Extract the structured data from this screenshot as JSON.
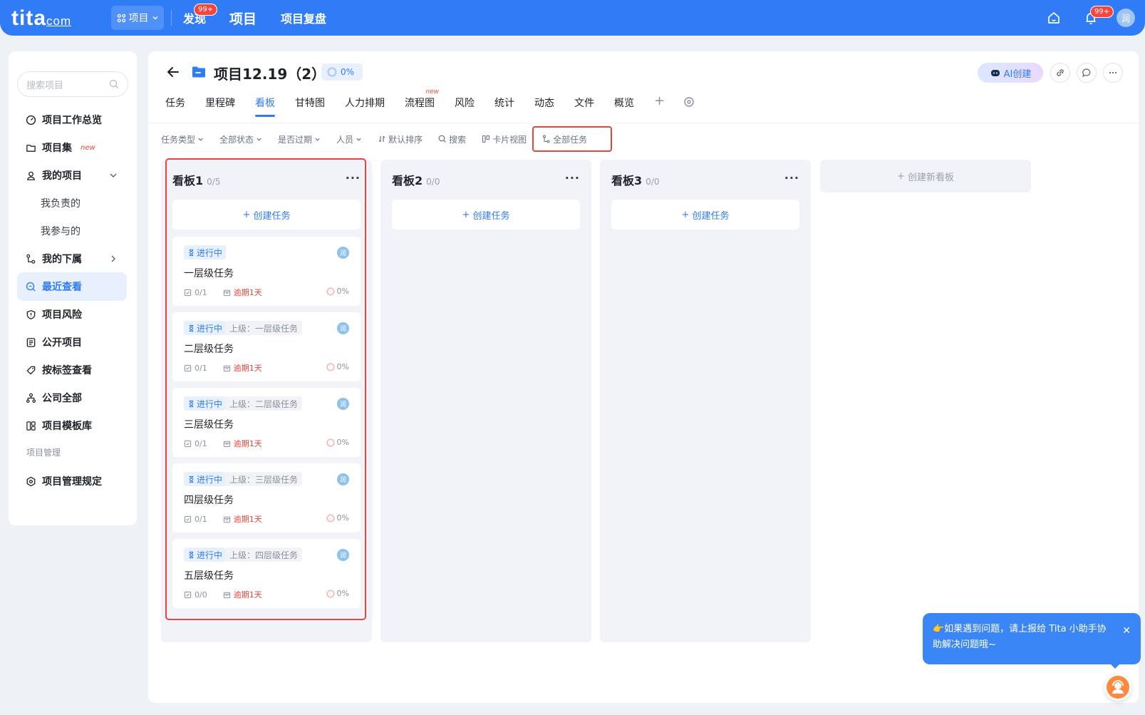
{
  "topbar": {
    "logo_text": "tita",
    "logo_suffix": "com",
    "app_switch_label": "项目",
    "nav": [
      {
        "label": "发现",
        "badge": "99+"
      },
      {
        "label": "项目"
      },
      {
        "label": "项目复盘"
      }
    ],
    "notification_badge": "99+",
    "avatar_text": "润"
  },
  "sidebar": {
    "search_placeholder": "搜索项目",
    "items": [
      {
        "label": "项目工作总览"
      },
      {
        "label": "项目集",
        "tag": "new"
      },
      {
        "label": "我的项目"
      },
      {
        "label": "我负责的"
      },
      {
        "label": "我参与的"
      },
      {
        "label": "我的下属"
      },
      {
        "label": "最近查看"
      },
      {
        "label": "项目风险"
      },
      {
        "label": "公开项目"
      },
      {
        "label": "按标签查看"
      },
      {
        "label": "公司全部"
      },
      {
        "label": "项目模板库"
      }
    ],
    "section_label": "项目管理",
    "bottom_item": "项目管理规定"
  },
  "project": {
    "title": "项目12.19（2）",
    "progress": "0%",
    "ai_button": "AI创建"
  },
  "tabs": [
    {
      "label": "任务"
    },
    {
      "label": "里程碑"
    },
    {
      "label": "看板",
      "active": true
    },
    {
      "label": "甘特图"
    },
    {
      "label": "人力排期"
    },
    {
      "label": "流程图",
      "tag": "new"
    },
    {
      "label": "风险"
    },
    {
      "label": "统计"
    },
    {
      "label": "动态"
    },
    {
      "label": "文件"
    },
    {
      "label": "概览"
    }
  ],
  "filters": [
    {
      "label": "任务类型"
    },
    {
      "label": "全部状态"
    },
    {
      "label": "是否过期"
    },
    {
      "label": "人员"
    },
    {
      "label": "默认排序"
    },
    {
      "label": "搜索"
    },
    {
      "label": "卡片视图"
    },
    {
      "label": "全部任务"
    }
  ],
  "boards": [
    {
      "name": "看板1",
      "count": "0/5",
      "create_label": "创建任务",
      "cards": [
        {
          "status": "进行中",
          "parent": "",
          "title": "一层级任务",
          "checklist": "0/1",
          "due": "逾期1天",
          "progress": "0%",
          "avatar": "润"
        },
        {
          "status": "进行中",
          "parent": "上级：一层级任务",
          "title": "二层级任务",
          "checklist": "0/1",
          "due": "逾期1天",
          "progress": "0%",
          "avatar": "润"
        },
        {
          "status": "进行中",
          "parent": "上级：二层级任务",
          "title": "三层级任务",
          "checklist": "0/1",
          "due": "逾期1天",
          "progress": "0%",
          "avatar": "润"
        },
        {
          "status": "进行中",
          "parent": "上级：三层级任务",
          "title": "四层级任务",
          "checklist": "0/1",
          "due": "逾期1天",
          "progress": "0%",
          "avatar": "润"
        },
        {
          "status": "进行中",
          "parent": "上级：四层级任务",
          "title": "五层级任务",
          "checklist": "0/0",
          "due": "逾期1天",
          "progress": "0%",
          "avatar": "润"
        }
      ]
    },
    {
      "name": "看板2",
      "count": "0/0",
      "create_label": "创建任务",
      "cards": []
    },
    {
      "name": "看板3",
      "count": "0/0",
      "create_label": "创建任务",
      "cards": []
    }
  ],
  "new_board_label": "创建新看板",
  "helper": {
    "message": "👉如果遇到问题，请上报给 Tita 小助手协助解决问题哦~"
  },
  "colors": {
    "primary": "#2f7cf6",
    "danger": "#e8453c",
    "board_bg": "#f1f3f8"
  }
}
